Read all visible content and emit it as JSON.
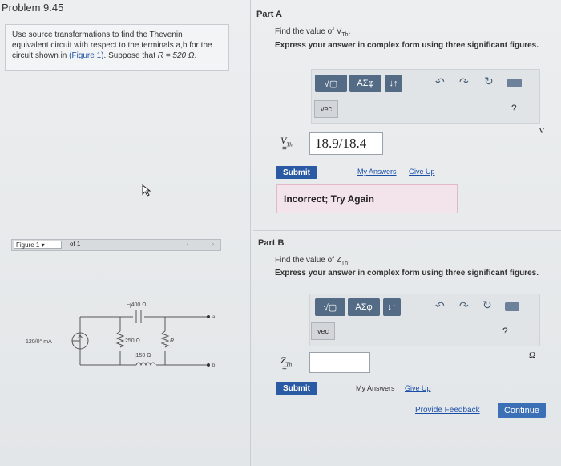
{
  "header": {
    "title": "Problem 9.45"
  },
  "problem": {
    "text_1": "Use source transformations to find the Thevenin",
    "text_2": "equivalent circuit with respect to the terminals a,b for the",
    "text_3": "circuit shown in",
    "figure_link": "(Figure 1)",
    "text_4": "Suppose that",
    "r_value": "R = 520 Ω"
  },
  "figure": {
    "label": "Figure 1",
    "of": "of 1",
    "circuit": {
      "source": "120/0° mA",
      "cap": "−j400 Ω",
      "r1": "250 Ω",
      "ind": "j150 Ω",
      "r": "R",
      "term_a": "a",
      "term_b": "b"
    }
  },
  "partA": {
    "label": "Part A",
    "question": "Find the value of V",
    "question_sub": "Th",
    "instruction": "Express your answer in complex form using three significant figures.",
    "toolbar": {
      "sqrt": "√▢",
      "greek": "ΑΣφ",
      "arrows": "↓↑",
      "vec": "vec",
      "help": "?"
    },
    "var": "V",
    "var_sub": "Th",
    "eq": "=",
    "answer": "18.9/18.4",
    "unit": "V",
    "submit": "Submit",
    "my_answers": "My Answers",
    "give_up": "Give Up",
    "feedback": "Incorrect; Try Again"
  },
  "partB": {
    "label": "Part B",
    "question": "Find the value of Z",
    "question_sub": "Th",
    "instruction": "Express your answer in complex form using three significant figures.",
    "toolbar": {
      "sqrt": "√▢",
      "greek": "ΑΣφ",
      "arrows": "↓↑",
      "vec": "vec",
      "help": "?"
    },
    "var": "Z",
    "var_sub": "Th",
    "eq": "=",
    "answer": "",
    "unit": "Ω",
    "submit": "Submit",
    "my_answers": "My Answers",
    "give_up": "Give Up"
  },
  "footer": {
    "provide_feedback": "Provide Feedback",
    "continue": "Continue"
  }
}
